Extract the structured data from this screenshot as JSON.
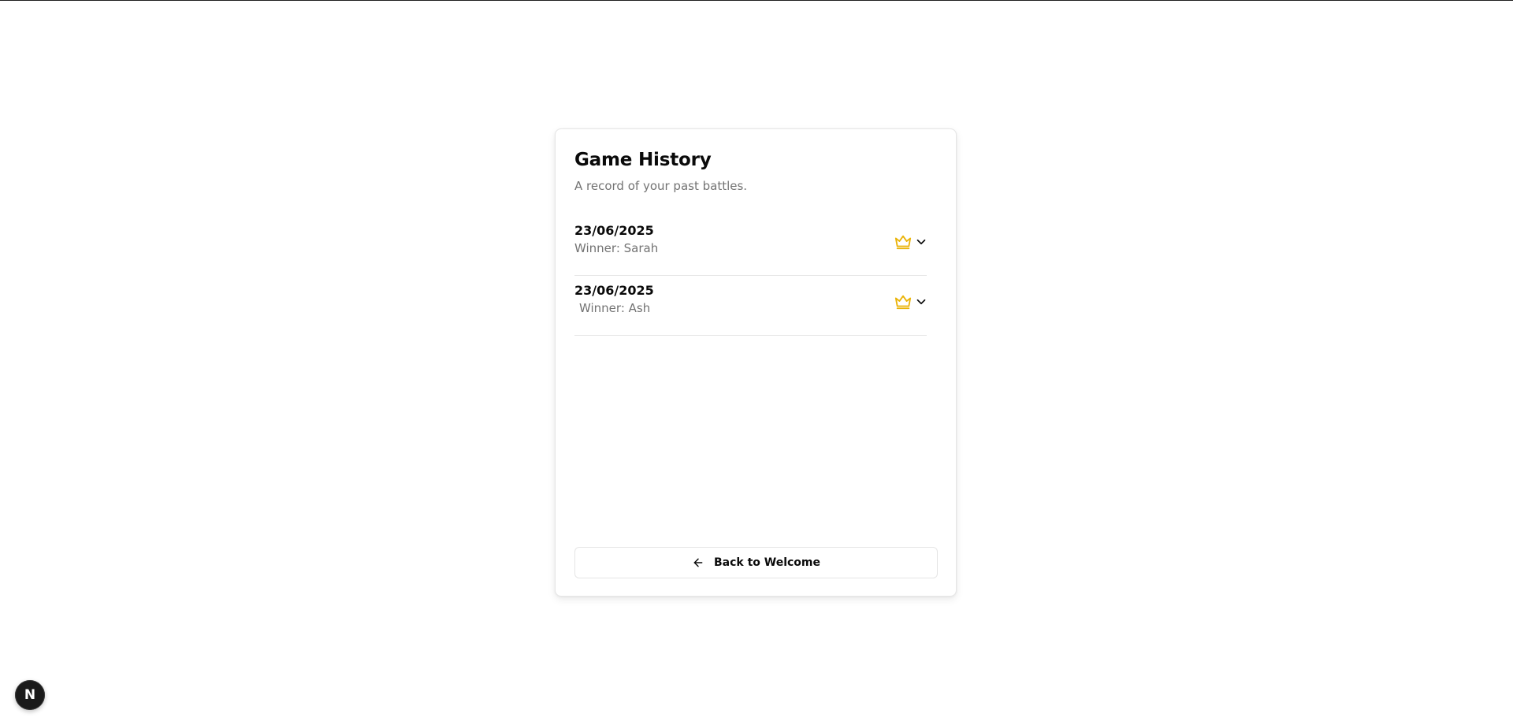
{
  "page": {
    "title": "Game History",
    "subtitle": "A record of your past battles."
  },
  "history": {
    "items": [
      {
        "date": "23/06/2025",
        "winner": "Winner: Sarah"
      },
      {
        "date": "23/06/2025",
        "winner": "Winner: Ash"
      }
    ]
  },
  "actions": {
    "back_label": "Back to Welcome"
  },
  "badge": {
    "letter": "N"
  },
  "icons": {
    "crown": "crown-icon",
    "chevron": "chevron-down-icon",
    "back": "arrow-left-icon"
  },
  "colors": {
    "crown": "#eab308",
    "muted_text": "#737373",
    "border": "#e5e5e5",
    "badge_bg": "#1a1a1a"
  }
}
